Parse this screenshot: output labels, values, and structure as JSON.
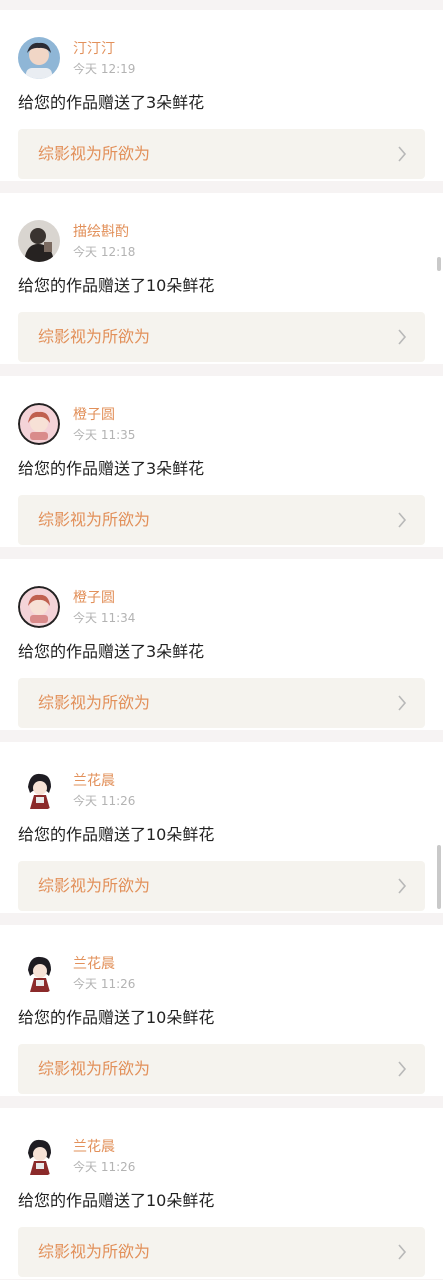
{
  "colors": {
    "accent": "#e2905a",
    "background": "#f6f3f3",
    "card": "#ffffff",
    "work_bg": "#f5f3ee",
    "text": "#222222",
    "muted": "#b3b3b3"
  },
  "notifications": [
    {
      "user": "汀汀汀",
      "time": "今天 12:19",
      "message": "给您的作品赠送了3朵鲜花",
      "work": "综影视为所欲为",
      "avatar_icon": "boy-portrait-avatar"
    },
    {
      "user": "描绘斟酌",
      "time": "今天 12:18",
      "message": "给您的作品赠送了10朵鲜花",
      "work": "综影视为所欲为",
      "avatar_icon": "dark-portrait-avatar"
    },
    {
      "user": "橙子圆",
      "time": "今天 11:35",
      "message": "给您的作品赠送了3朵鲜花",
      "work": "综影视为所欲为",
      "avatar_icon": "anime-girl-avatar"
    },
    {
      "user": "橙子圆",
      "time": "今天 11:34",
      "message": "给您的作品赠送了3朵鲜花",
      "work": "综影视为所欲为",
      "avatar_icon": "anime-girl-avatar"
    },
    {
      "user": "兰花晨",
      "time": "今天 11:26",
      "message": "给您的作品赠送了10朵鲜花",
      "work": "综影视为所欲为",
      "avatar_icon": "chibi-character-avatar"
    },
    {
      "user": "兰花晨",
      "time": "今天 11:26",
      "message": "给您的作品赠送了10朵鲜花",
      "work": "综影视为所欲为",
      "avatar_icon": "chibi-character-avatar"
    },
    {
      "user": "兰花晨",
      "time": "今天 11:26",
      "message": "给您的作品赠送了10朵鲜花",
      "work": "综影视为所欲为",
      "avatar_icon": "chibi-character-avatar"
    }
  ]
}
